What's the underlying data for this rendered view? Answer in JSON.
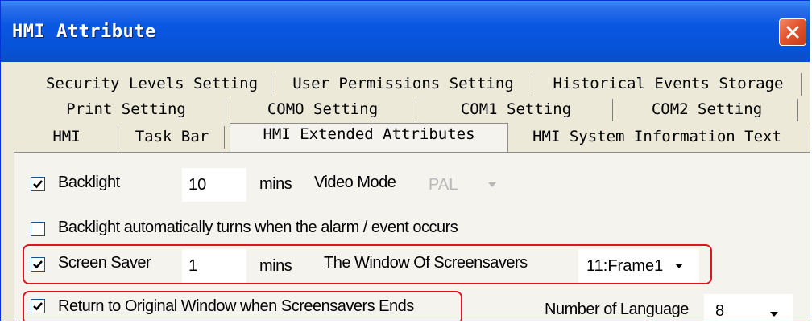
{
  "window": {
    "title": "HMI Attribute"
  },
  "tabs": {
    "row1": [
      "Security Levels Setting",
      "User Permissions Setting",
      "Historical Events Storage"
    ],
    "row2": [
      "Print Setting",
      "COMO Setting",
      "COM1 Setting",
      "COM2 Setting"
    ],
    "row3": [
      "HMI",
      "Task Bar",
      "HMI Extended Attributes",
      "HMI System Information Text"
    ],
    "active": "HMI Extended Attributes"
  },
  "settings": {
    "backlight": {
      "label": "Backlight",
      "checked": true,
      "value": "10",
      "unit": "mins"
    },
    "video_mode": {
      "label": "Video Mode",
      "value": "PAL",
      "disabled": true
    },
    "backlight_alarm": {
      "label": "Backlight automatically turns when the alarm / event occurs",
      "checked": false
    },
    "screen_saver": {
      "label": "Screen Saver",
      "checked": true,
      "value": "1",
      "unit": "mins"
    },
    "screensaver_window": {
      "label": "The Window Of Screensavers",
      "value": "11:Frame1"
    },
    "return_original": {
      "label": "Return to Original Window when Screensavers Ends",
      "checked": true
    },
    "language_count": {
      "label": "Number of Language",
      "value": "8"
    }
  },
  "colors": {
    "titlebar": "#0a58e2",
    "highlight": "#e0141c",
    "dialog_bg": "#ece9d8"
  }
}
